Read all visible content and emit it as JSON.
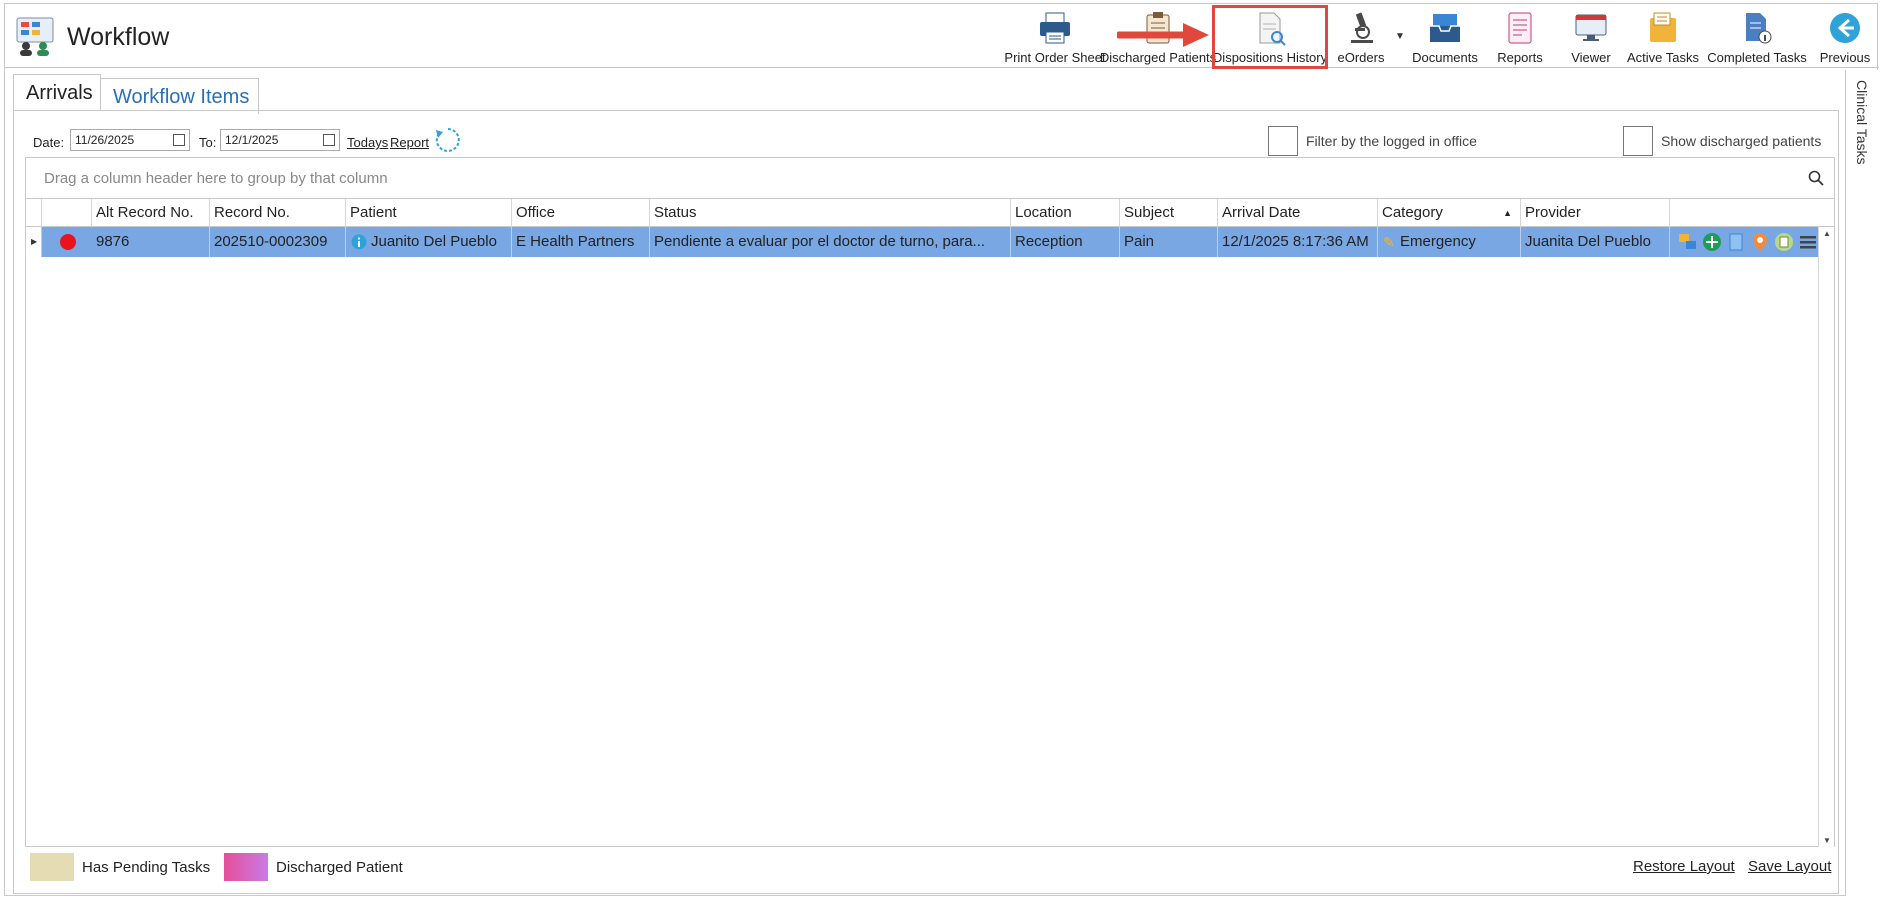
{
  "header": {
    "title": "Workflow",
    "toolbar": [
      {
        "name": "print-order-sheet-button",
        "label": "Print Order Sheet",
        "icon": "printer-icon"
      },
      {
        "name": "discharged-patients-button",
        "label": "Discharged Patients",
        "icon": "clipboard-icon"
      },
      {
        "name": "dispositions-history-button",
        "label": "Dispositions History",
        "icon": "document-search-icon"
      },
      {
        "name": "eorders-button",
        "label": "eOrders",
        "icon": "microscope-icon"
      },
      {
        "name": "documents-button",
        "label": "Documents",
        "icon": "inbox-tray-icon"
      },
      {
        "name": "reports-button",
        "label": "Reports",
        "icon": "report-list-icon"
      },
      {
        "name": "viewer-button",
        "label": "Viewer",
        "icon": "monitor-icon"
      },
      {
        "name": "active-tasks-button",
        "label": "Active Tasks",
        "icon": "task-folder-icon"
      },
      {
        "name": "completed-tasks-button",
        "label": "Completed Tasks",
        "icon": "document-info-icon"
      },
      {
        "name": "previous-button",
        "label": "Previous",
        "icon": "arrow-left-icon"
      }
    ]
  },
  "side_tab": {
    "label": "Clinical Tasks"
  },
  "tabs": [
    {
      "label": "Arrivals",
      "active": true
    },
    {
      "label": "Workflow Items",
      "active": false
    }
  ],
  "filters": {
    "date_label": "Date:",
    "date_from": "11/26/2025",
    "to_label": "To:",
    "date_to": "12/1/2025",
    "todays_link": "Todays",
    "report_link": "Report",
    "filter_office_label": "Filter by the logged in office",
    "show_discharged_label": "Show discharged patients"
  },
  "grid": {
    "group_panel_text": "Drag a column header here to group by that column",
    "columns": [
      "Alt Record No.",
      "Record No.",
      "Patient",
      "Office",
      "Status",
      "Location",
      "Subject",
      "Arrival Date",
      "Category",
      "Provider"
    ],
    "rows": [
      {
        "alt_record_no": "9876",
        "record_no": "202510-0002309",
        "patient": "Juanito Del Pueblo",
        "office": "E Health Partners",
        "status": "Pendiente a evaluar por el doctor de turno, para...",
        "location": "Reception",
        "subject": "Pain",
        "arrival_date": "12/1/2025 8:17:36 AM",
        "category": "Emergency",
        "provider": "Juanita Del Pueblo"
      }
    ]
  },
  "legend": {
    "pending_label": "Has Pending Tasks",
    "discharged_label": "Discharged Patient",
    "pending_color": "#e6dcb4",
    "discharged_color": "#e54f9a"
  },
  "footer": {
    "restore_layout": "Restore Layout",
    "save_layout": "Save Layout"
  },
  "colors": {
    "selected_row": "#79a7e3",
    "link_blue": "#2a6fb6",
    "highlight_red": "#e0483c"
  }
}
